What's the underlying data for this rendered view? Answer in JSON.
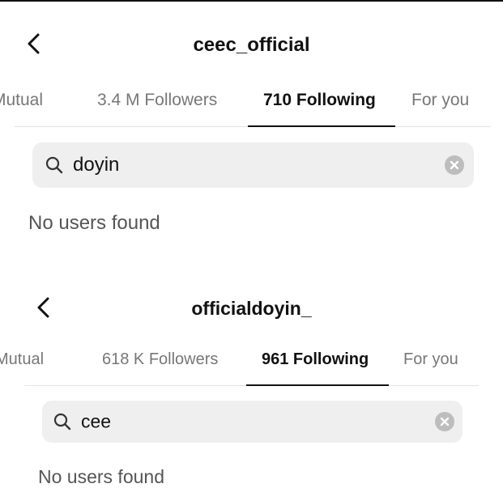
{
  "screens": [
    {
      "title": "ceec_official",
      "tabs": [
        "Mutual",
        "3.4 M Followers",
        "710 Following",
        "For you"
      ],
      "active_tab": "710 Following",
      "search_value": "doyin",
      "empty_message": "No users found"
    },
    {
      "title": "officialdoyin_",
      "tabs": [
        "Mutual",
        "618 K Followers",
        "961 Following",
        "For you"
      ],
      "active_tab": "961 Following",
      "search_value": "cee",
      "empty_message": "No users found"
    }
  ],
  "icons": {
    "back": "chevron-left-icon",
    "search": "search-icon",
    "clear": "close-circle-icon"
  }
}
